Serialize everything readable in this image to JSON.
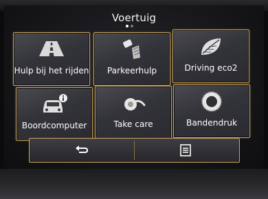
{
  "header": {
    "title": "Voertuig",
    "page_indicator": {
      "current": 1,
      "total": 2
    }
  },
  "tiles": [
    {
      "label": "Hulp bij het rijden",
      "icon": "road-icon"
    },
    {
      "label": "Parkeerhulp",
      "icon": "parking-sensor-icon"
    },
    {
      "label": "Driving eco2",
      "icon": "leaf-icon"
    },
    {
      "label": "Boordcomputer",
      "icon": "car-info-icon"
    },
    {
      "label": "Take care",
      "icon": "air-freshener-icon"
    },
    {
      "label": "Bandendruk",
      "icon": "tyre-icon"
    }
  ],
  "bottom_bar": {
    "back_icon": "back-arrow-icon",
    "menu_icon": "menu-list-icon"
  },
  "colors": {
    "accent_border": "#c9a55a",
    "text": "#ffffff",
    "tile_bg": "#3a3a40"
  }
}
